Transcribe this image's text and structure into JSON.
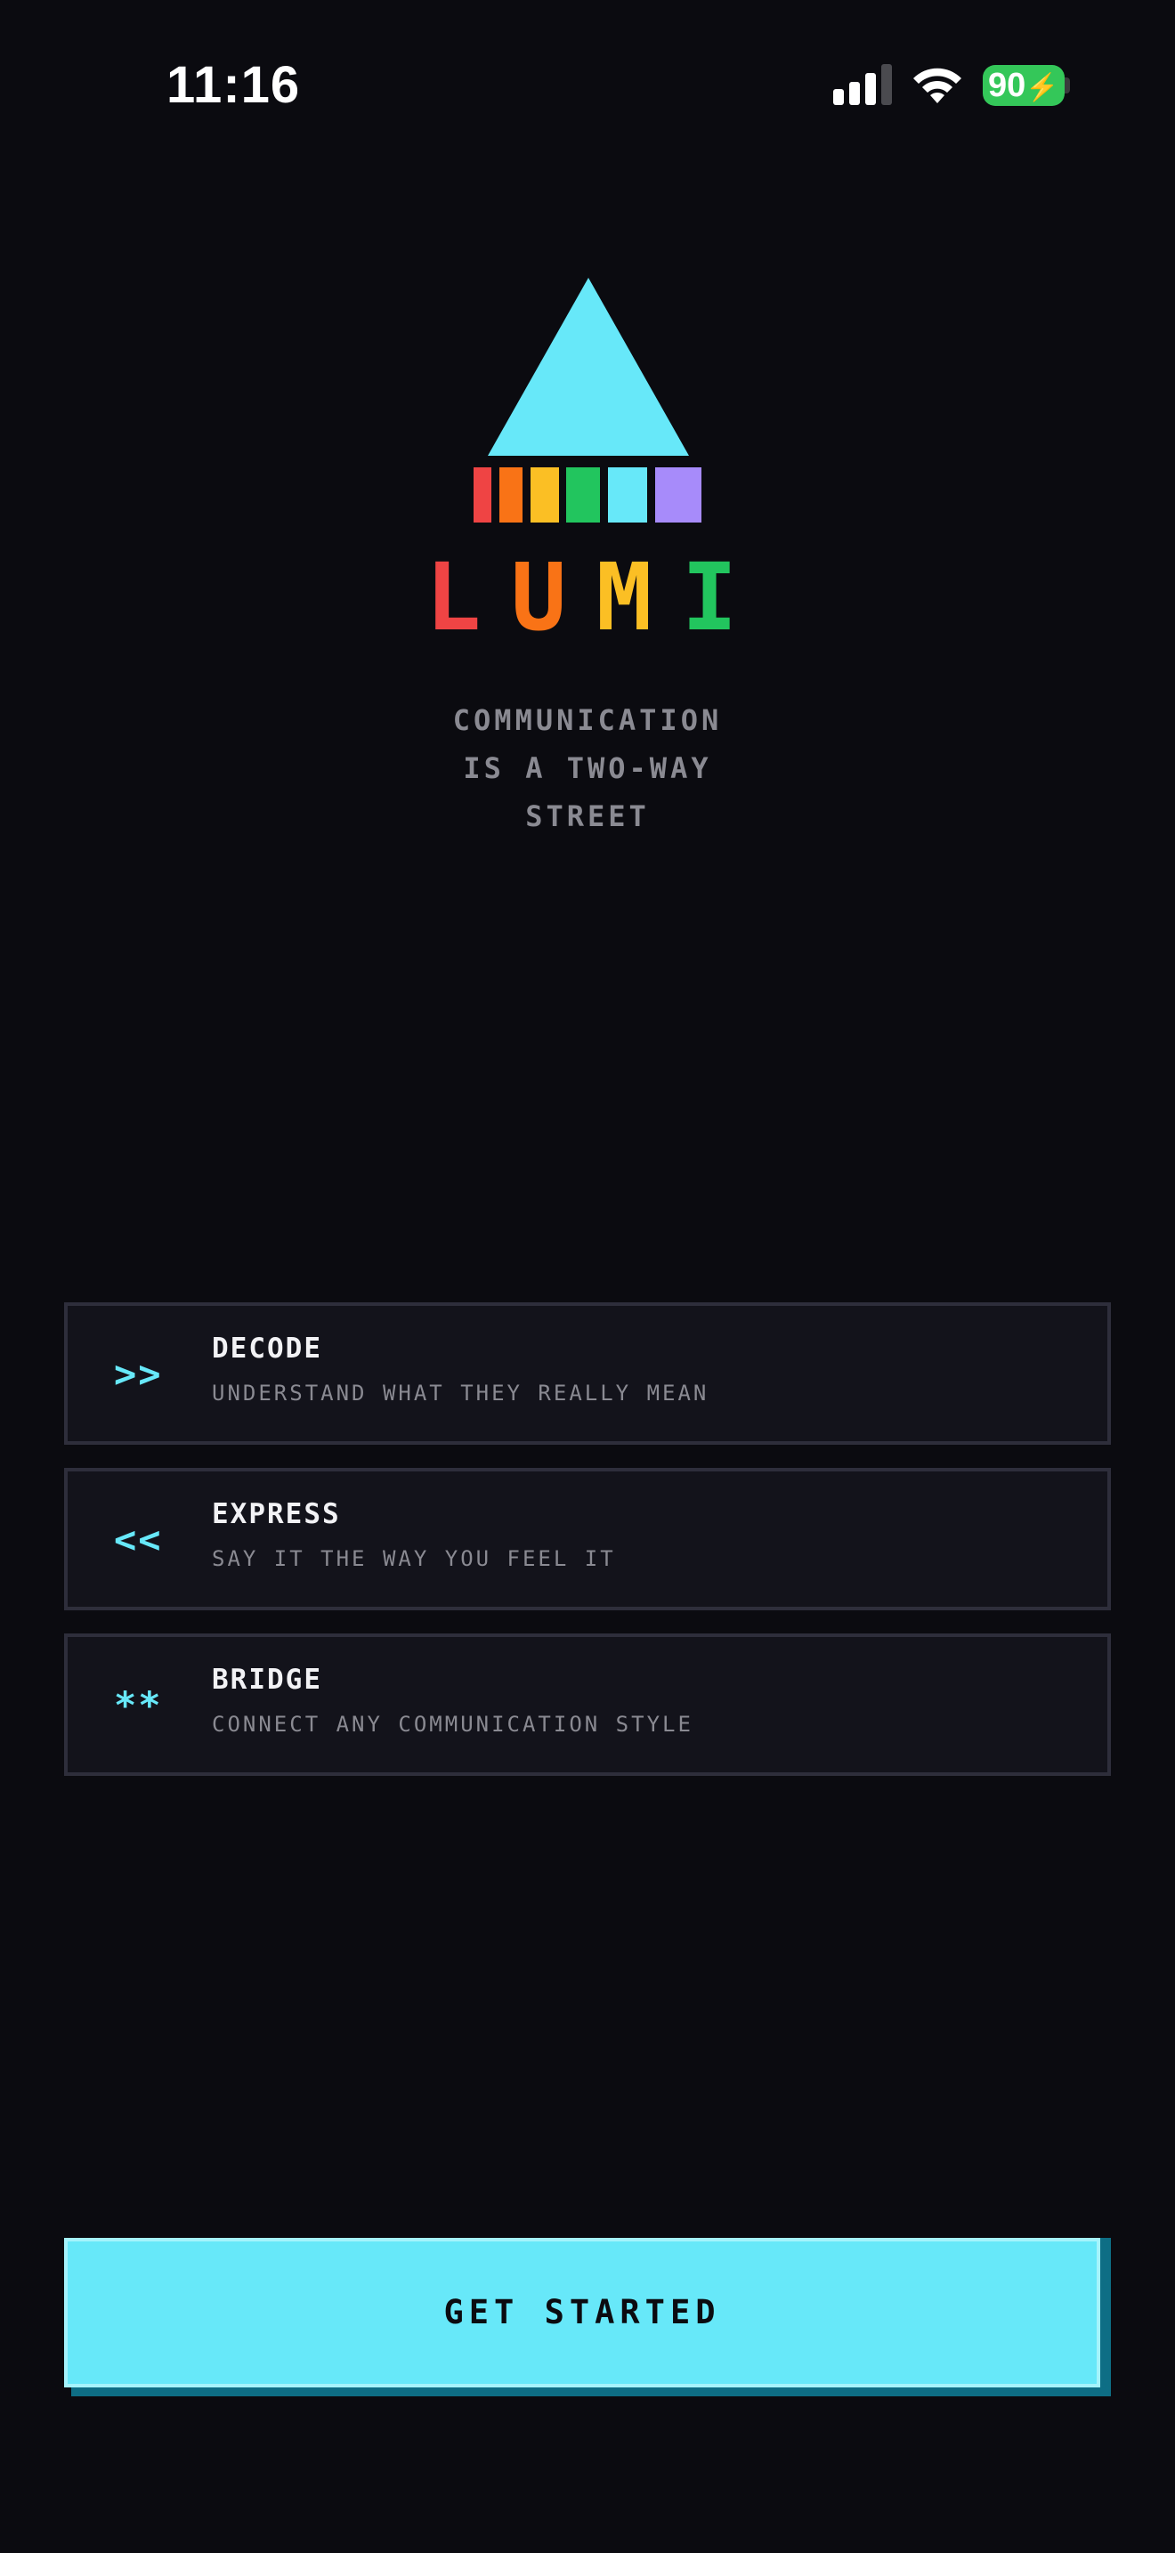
{
  "status_bar": {
    "time": "11:16",
    "battery": "90",
    "signal_icon": "signal-bars-icon",
    "wifi_icon": "wifi-icon",
    "battery_icon": "battery-charging-icon"
  },
  "logo": {
    "triangle_color": "#67e8f9",
    "strip_colors": [
      "#ef4444",
      "#f97316",
      "#fbbf24",
      "#22c55e",
      "#67e8f9",
      "#a78bfa"
    ],
    "wordmark_letters": [
      "L",
      "U",
      "M",
      "I"
    ],
    "wordmark_colors": [
      "#ef4444",
      "#f97316",
      "#fbbf24",
      "#22c55e"
    ]
  },
  "tagline": {
    "line1": "COMMUNICATION",
    "line2": "IS A TWO-WAY",
    "line3": "STREET"
  },
  "features": [
    {
      "icon": ">>",
      "icon_name": "double-chevron-right-icon",
      "title": "DECODE",
      "subtitle": "UNDERSTAND WHAT THEY REALLY MEAN"
    },
    {
      "icon": "<<",
      "icon_name": "double-chevron-left-icon",
      "title": "EXPRESS",
      "subtitle": "SAY IT THE WAY YOU FEEL IT"
    },
    {
      "icon": "**",
      "icon_name": "double-asterisk-icon",
      "title": "BRIDGE",
      "subtitle": "CONNECT ANY COMMUNICATION STYLE"
    }
  ],
  "cta": {
    "label": "GET STARTED"
  },
  "colors": {
    "background": "#0b0b10",
    "accent": "#67e8f9",
    "card_bg": "#13131b",
    "card_border": "#2e2e3b",
    "muted_text": "#8a8a92"
  }
}
